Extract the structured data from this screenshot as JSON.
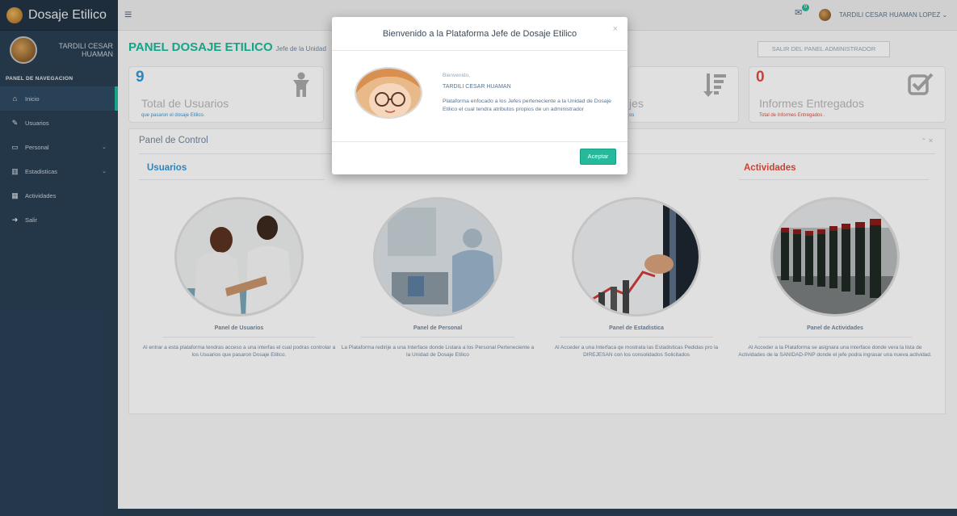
{
  "app": {
    "title": "Dosaje Etilico"
  },
  "sidebar": {
    "profile_name": "TARDILI CESAR HUAMAN",
    "heading": "PANEL DE NAVEGACION",
    "items": [
      {
        "label": "Inicio",
        "icon": "home-icon"
      },
      {
        "label": "Usuarios",
        "icon": "edit-icon"
      },
      {
        "label": "Personal",
        "icon": "desktop-icon"
      },
      {
        "label": "Estadisticas",
        "icon": "bar-chart-icon"
      },
      {
        "label": "Actividades",
        "icon": "table-icon"
      },
      {
        "label": "Salir",
        "icon": "sign-out-icon"
      }
    ]
  },
  "topbar": {
    "notification_count": "0",
    "user_name": "TARDILI CESAR HUAMAN LOPEZ"
  },
  "header": {
    "title": "PANEL DOSAJE ETILICO",
    "subtitle": "Jefe de la Unidad",
    "exit_button": "SALIR DEL PANEL ADMINISTRADOR"
  },
  "tiles": [
    {
      "count": "9",
      "label": "Total de Usuarios",
      "note": "que pasaron el dosaje Etilico.",
      "count_color": "#3498db",
      "note_color": "#3498db"
    },
    {
      "count": "",
      "label": "jes",
      "note": "os",
      "count_color": "#3498db",
      "note_color": "#3498db"
    },
    {
      "count": "0",
      "label": "Informes Entregados",
      "note": "Total de Informes Entregados .",
      "count_color": "#e74c3c",
      "note_color": "#e74c3c"
    }
  ],
  "panel": {
    "title": "Panel de Control"
  },
  "columns": [
    {
      "heading": "Usuarios",
      "color": "#3498db"
    },
    {
      "heading": "Actividades",
      "color": "#e74c3c"
    }
  ],
  "cards": [
    {
      "title": "Panel de Usuarios",
      "desc": "Al entrar a esta plataforma tendras acceso a una interfas el cual podras controlar a los Usuarios que pasaron Dosaje Etilico."
    },
    {
      "title": "Panel de Personal",
      "desc": "La Plataforma redirije a una Interface donde Listara a los Personal Perteneciente a la Unidad de Dosaje Etilico"
    },
    {
      "title": "Panel de Estadistica",
      "desc": "Al Acceder a una Interfaca qe mostrata las Estadisticas Pedidas pro la DIREJESAN con los consolidados Solicitados"
    },
    {
      "title": "Panel de Actividades",
      "desc": "Al Acceder a la Plataforma se asignara una interface donde vera la lista de Actividades de la SANIDAD-PNP donde el jefe podra ingrasar una nueva actividad."
    }
  ],
  "modal": {
    "title": "Bienvenido a la Plataforma Jefe de Dosaje Etilico",
    "greeting": "Bienvenido,",
    "name": "TARDILI CESAR HUAMAN",
    "text": "Plataforma enfocado a los Jefes perteneciente a la Unidad de Dosaje Etilico el cual tendra atributos propios de un administrador",
    "accept": "Aceptar",
    "close": "×"
  }
}
